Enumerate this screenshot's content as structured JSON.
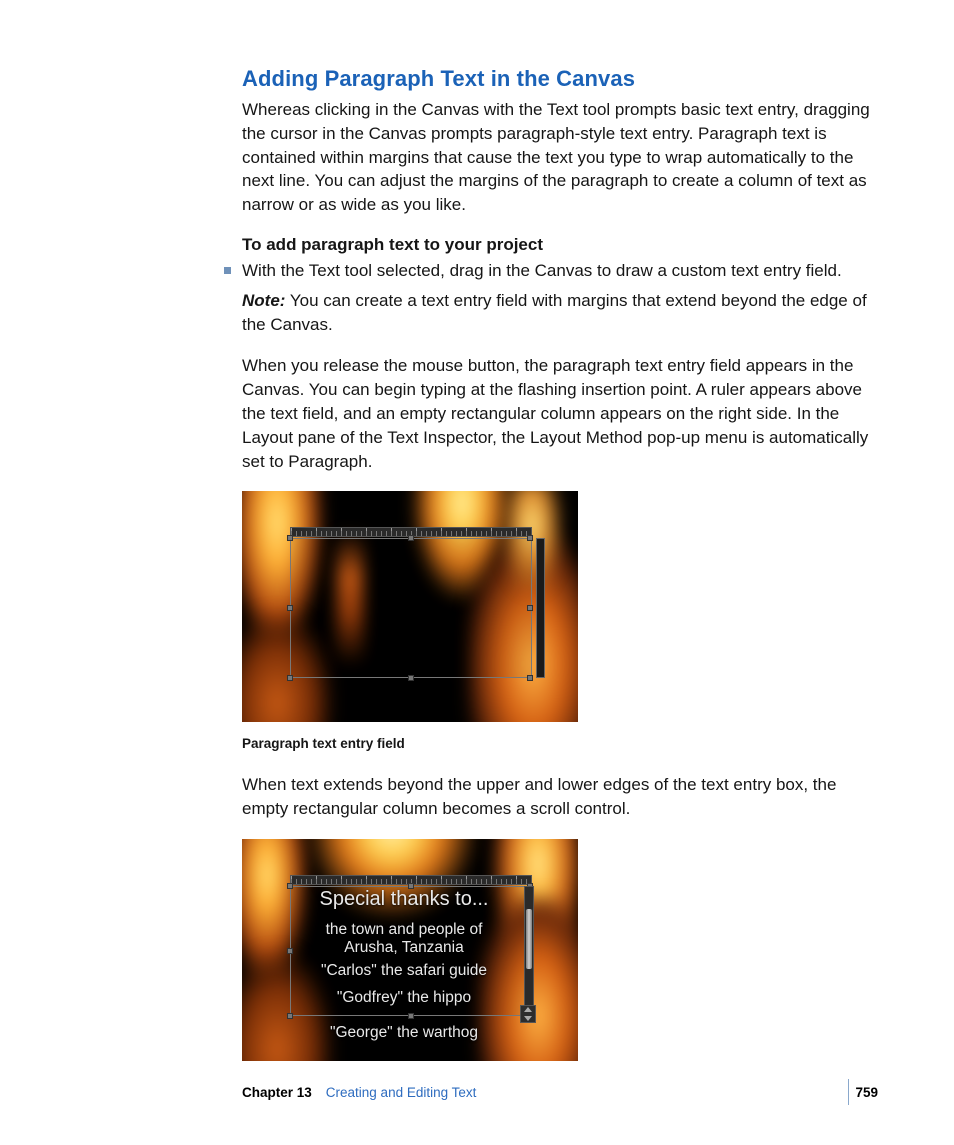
{
  "heading": "Adding Paragraph Text in the Canvas",
  "intro": "Whereas clicking in the Canvas with the Text tool prompts basic text entry, dragging the cursor in the Canvas prompts paragraph-style text entry. Paragraph text is contained within margins that cause the text you type to wrap automatically to the next line. You can adjust the margins of the paragraph to create a column of text as narrow or as wide as you like.",
  "step_heading": "To add paragraph text to your project",
  "bullet": "With the Text tool selected, drag in the Canvas to draw a custom text entry field.",
  "note_label": "Note:",
  "note_text": "  You can create a text entry field with margins that extend beyond the edge of the Canvas.",
  "para2": "When you release the mouse button, the paragraph text entry field appears in the Canvas. You can begin typing at the flashing insertion point. A ruler appears above the text field, and an empty rectangular column appears on the right side. In the Layout pane of the Text Inspector, the Layout Method pop-up menu is automatically set to Paragraph.",
  "caption1": "Paragraph text entry field",
  "para3": "When text extends beyond the upper and lower edges of the text entry box, the empty rectangular column becomes a scroll control.",
  "credits": {
    "l1": "Special thanks to...",
    "l2a": "the town and people of",
    "l2b": "Arusha, Tanzania",
    "l3": "\"Carlos\" the safari guide",
    "l4": "\"Godfrey\" the hippo",
    "l5": "\"George\" the warthog"
  },
  "footer": {
    "chapter": "Chapter 13",
    "title": "Creating and Editing Text",
    "page": "759"
  }
}
